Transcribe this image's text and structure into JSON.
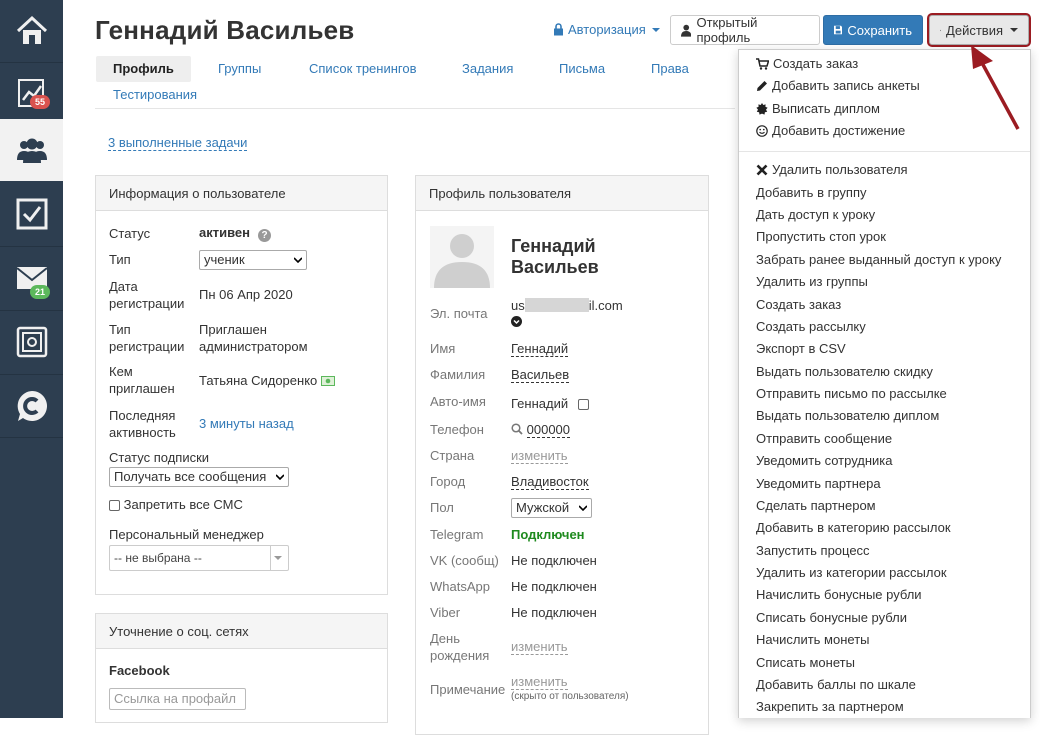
{
  "colors": {
    "sidebar": "#2d3e50",
    "primary": "#337ab7",
    "annotation": "#9b1c22",
    "green": "#1e8a1e"
  },
  "sidebar": {
    "items": [
      {
        "icon": "home-icon"
      },
      {
        "icon": "chart-icon",
        "badge": "55"
      },
      {
        "icon": "users-icon",
        "active": true
      },
      {
        "icon": "checkbox-icon"
      },
      {
        "icon": "mail-icon",
        "badge": "21"
      },
      {
        "icon": "safe-icon"
      },
      {
        "icon": "chat-logo-icon"
      }
    ]
  },
  "header": {
    "title": "Геннадий Васильев",
    "auth_label": "Авторизация",
    "open_profile_label": "Открытый профиль",
    "save_label": "Сохранить",
    "actions_label": "Действия"
  },
  "tabs": [
    {
      "label": "Профиль",
      "active": true
    },
    {
      "label": "Группы"
    },
    {
      "label": "Список тренингов"
    },
    {
      "label": "Задания"
    },
    {
      "label": "Письма"
    },
    {
      "label": "Права"
    },
    {
      "label": "Тестирования"
    }
  ],
  "tasks_link": "3 выполненные задачи",
  "user_info": {
    "heading": "Информация о пользователе",
    "status_label": "Статус",
    "status_value": "активен",
    "type_label": "Тип",
    "type_value": "ученик",
    "reg_date_label_1": "Дата",
    "reg_date_label_2": "регистрации",
    "reg_date_value": "Пн 06 Апр 2020",
    "reg_type_label_1": "Тип",
    "reg_type_label_2": "регистрации",
    "reg_type_value_1": "Приглашен",
    "reg_type_value_2": "администратором",
    "invited_label_1": "Кем",
    "invited_label_2": "приглашен",
    "invited_value": "Татьяна Сидоренко",
    "activity_label_1": "Последняя",
    "activity_label_2": "активность",
    "activity_value": "3 минуты назад",
    "subscription_label": "Статус подписки",
    "subscription_value": "Получать все сообщения",
    "sms_label": "Запретить все СМС",
    "manager_label": "Персональный менеджер",
    "manager_value": "-- не выбрана --"
  },
  "social": {
    "heading": "Уточнение о соц. сетях",
    "facebook_label": "Facebook",
    "facebook_placeholder": "Ссылка на профайл"
  },
  "profile": {
    "heading": "Профиль пользователя",
    "name_line1": "Геннадий",
    "name_line2": "Васильев",
    "email_label": "Эл. почта",
    "email_prefix": "us",
    "email_suffix": "il.com",
    "first_name_label": "Имя",
    "first_name": "Геннадий",
    "last_name_label": "Фамилия",
    "last_name": "Васильев",
    "autoname_label": "Авто-имя",
    "autoname_value": "Геннадий",
    "phone_label": "Телефон",
    "phone_value": "000000",
    "country_label": "Страна",
    "country_value": "изменить",
    "city_label": "Город",
    "city_value": "Владивосток",
    "gender_label": "Пол",
    "gender_value": "Мужской",
    "telegram_label": "Telegram",
    "telegram_value": "Подключен",
    "vk_label": "VK (сообщ)",
    "vk_value": "Не подключен",
    "whatsapp_label": "WhatsApp",
    "whatsapp_value": "Не подключен",
    "viber_label": "Viber",
    "viber_value": "Не подключен",
    "birthday_label_1": "День",
    "birthday_label_2": "рождения",
    "birthday_value": "изменить",
    "note_label": "Примечание",
    "note_value": "изменить",
    "note_hint": "(скрыто от пользователя)"
  },
  "actions_menu": {
    "group1": [
      {
        "label": "Создать заказ",
        "icon": "cart-icon"
      },
      {
        "label": "Добавить запись анкеты",
        "icon": "pencil-icon"
      },
      {
        "label": "Выписать диплом",
        "icon": "certificate-icon"
      },
      {
        "label": "Добавить достижение",
        "icon": "smile-icon"
      }
    ],
    "group2": [
      {
        "label": "Удалить пользователя",
        "icon": "delete-icon"
      },
      {
        "label": "Добавить в группу"
      },
      {
        "label": "Дать доступ к уроку"
      },
      {
        "label": "Пропустить стоп урок"
      },
      {
        "label": "Забрать ранее выданный доступ к уроку"
      },
      {
        "label": "Удалить из группы"
      },
      {
        "label": "Создать заказ"
      },
      {
        "label": "Создать рассылку"
      },
      {
        "label": "Экспорт в CSV"
      },
      {
        "label": "Выдать пользователю скидку"
      },
      {
        "label": "Отправить письмо по рассылке"
      },
      {
        "label": "Выдать пользователю диплом"
      },
      {
        "label": "Отправить сообщение"
      },
      {
        "label": "Уведомить сотрудника"
      },
      {
        "label": "Уведомить партнера"
      },
      {
        "label": "Сделать партнером"
      },
      {
        "label": "Добавить в категорию рассылок"
      },
      {
        "label": "Запустить процесс"
      },
      {
        "label": "Удалить из категории рассылок"
      },
      {
        "label": "Начислить бонусные рубли"
      },
      {
        "label": "Списать бонусные рубли"
      },
      {
        "label": "Начислить монеты"
      },
      {
        "label": "Списать монеты"
      },
      {
        "label": "Добавить баллы по шкале"
      },
      {
        "label": "Закрепить за партнером"
      }
    ]
  }
}
